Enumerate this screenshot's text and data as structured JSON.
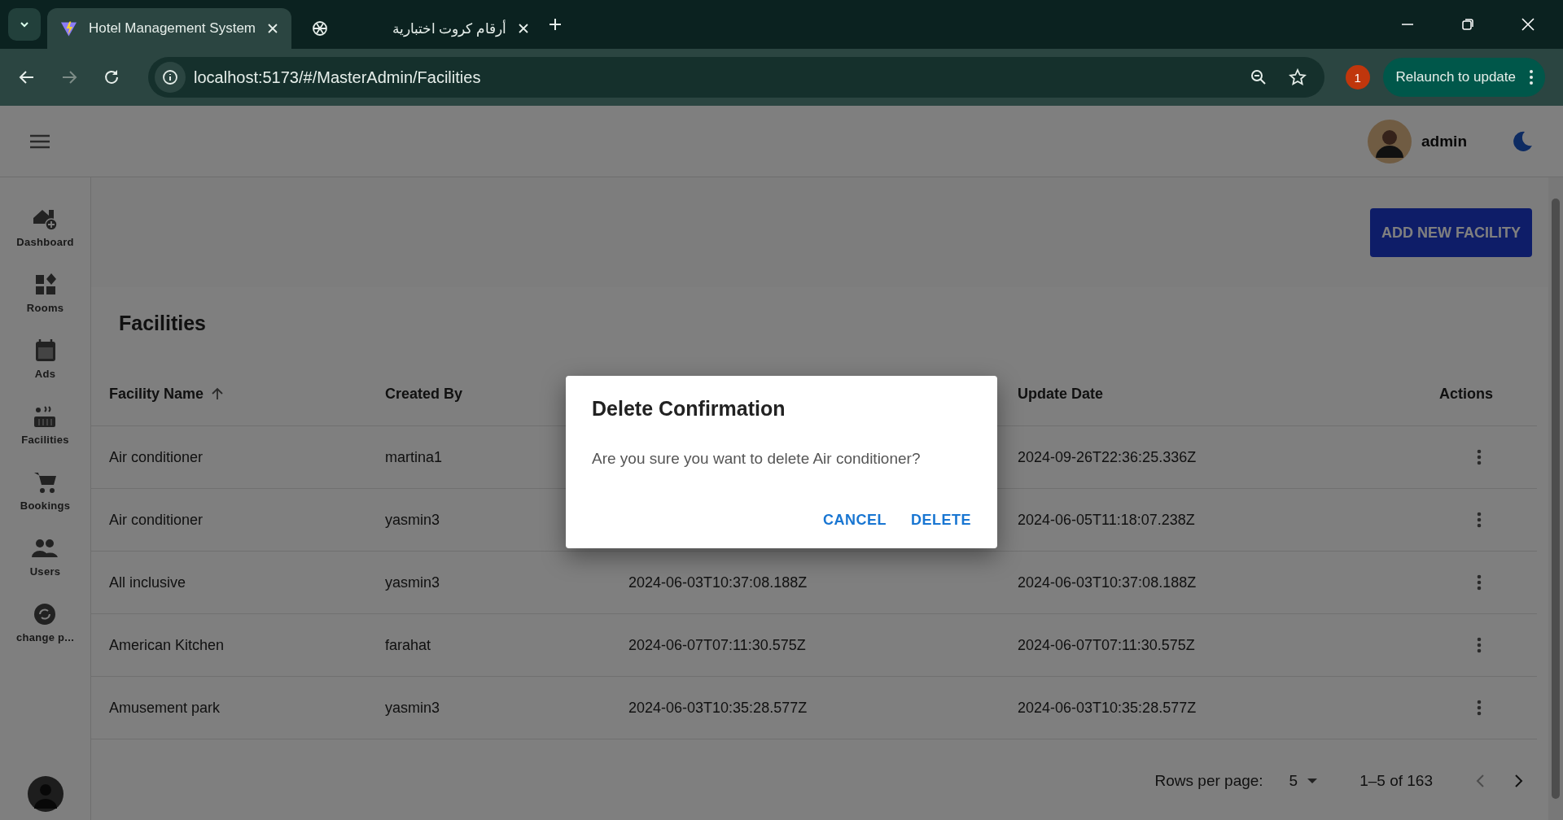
{
  "browser": {
    "tabs": [
      {
        "title": "Hotel Management System",
        "selected": true,
        "kind": "bolt"
      },
      {
        "title": "أرقام كروت اختبارية",
        "selected": false,
        "kind": "knot"
      }
    ],
    "url": "localhost:5173/#/MasterAdmin/Facilities",
    "notification_count": "1",
    "relaunch_label": "Relaunch to update"
  },
  "header": {
    "user_name": "admin"
  },
  "sidebar": {
    "items": [
      {
        "label": "Dashboard",
        "kind": "dashboard"
      },
      {
        "label": "Rooms",
        "kind": "rooms"
      },
      {
        "label": "Ads",
        "kind": "ads"
      },
      {
        "label": "Facilities",
        "kind": "facilities"
      },
      {
        "label": "Bookings",
        "kind": "bookings"
      },
      {
        "label": "Users",
        "kind": "users"
      },
      {
        "label": "change p...",
        "kind": "change"
      }
    ]
  },
  "page": {
    "add_button": "ADD NEW FACILITY",
    "title": "Facilities"
  },
  "table": {
    "columns": [
      {
        "label": "Facility Name",
        "sorted": true
      },
      {
        "label": "Created By",
        "sorted": false
      },
      {},
      {
        "label": "Update Date",
        "sorted": false
      },
      {
        "label": "Actions",
        "sorted": false
      }
    ],
    "rows": [
      {
        "cells": [
          "Air conditioner",
          "martina1",
          null,
          "2024-09-26T22:36:25.336Z"
        ]
      },
      {
        "cells": [
          "Air conditioner",
          "yasmin3",
          null,
          "2024-06-05T11:18:07.238Z"
        ]
      },
      {
        "cells": [
          "All inclusive",
          "yasmin3",
          "2024-06-03T10:37:08.188Z",
          "2024-06-03T10:37:08.188Z"
        ]
      },
      {
        "cells": [
          "American Kitchen",
          "farahat",
          "2024-06-07T07:11:30.575Z",
          "2024-06-07T07:11:30.575Z"
        ]
      },
      {
        "cells": [
          "Amusement park",
          "yasmin3",
          "2024-06-03T10:35:28.577Z",
          "2024-06-03T10:35:28.577Z"
        ]
      }
    ]
  },
  "pagination": {
    "rows_per_page_label": "Rows per page:",
    "rows_per_page": "5",
    "range": "1–5 of 163",
    "previous_disabled": true,
    "next_disabled": false
  },
  "dialog": {
    "title": "Delete Confirmation",
    "message": "Are you sure you want to delete Air conditioner?",
    "buttons": [
      "CANCEL",
      "DELETE"
    ]
  }
}
